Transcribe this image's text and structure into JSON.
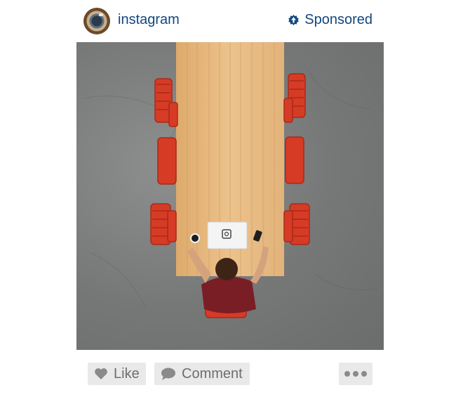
{
  "post": {
    "author": {
      "username": "instagram",
      "avatar_icon": "instagram-camera-logo-icon"
    },
    "sponsored_label": "Sponsored",
    "sponsored_icon": "sponsored-badge-icon",
    "photo": {
      "subject": "overhead view of a long wooden table with red chairs, a man with a laptop and coffee",
      "laptop_logo_icon": "instagram-logo-icon"
    }
  },
  "actions": {
    "like_label": "Like",
    "like_icon": "heart-icon",
    "comment_label": "Comment",
    "comment_icon": "speech-bubble-icon",
    "more_icon": "ellipsis-icon"
  },
  "colors": {
    "link_blue": "#12477e",
    "button_bg": "#e9e9e9",
    "button_text": "#6e6e6e",
    "chair_red": "#d63b26",
    "table_wood": "#e6b77c"
  }
}
